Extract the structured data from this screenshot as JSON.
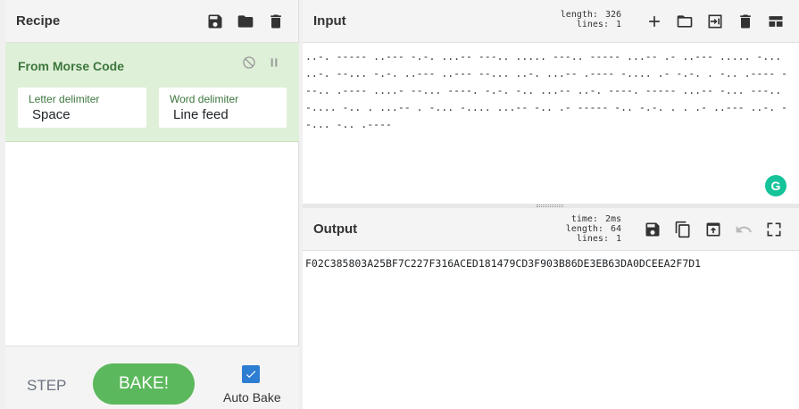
{
  "recipe": {
    "title": "Recipe",
    "icons": [
      "save-icon",
      "folder-icon",
      "trash-icon"
    ],
    "operation": {
      "name": "From Morse Code",
      "letter_delimiter": {
        "label": "Letter delimiter",
        "value": "Space"
      },
      "word_delimiter": {
        "label": "Word delimiter",
        "value": "Line feed"
      }
    },
    "controls": {
      "step_label": "STEP",
      "bake_label": "BAKE!",
      "auto_bake_label": "Auto Bake",
      "auto_bake_checked": true
    }
  },
  "input": {
    "title": "Input",
    "length_label": "length:",
    "length_value": "326",
    "lines_label": "lines:",
    "lines_value": "1",
    "text": "..-. ----- ..--- -.-. ...-- ---.. ..... ---.. ----- ...-- .- ..--- ..... -... ..-. --... -.-. ..--- ..--- --... ..-. ...-- .---- -.... .- -.-. . -.. .---- ---.. .---- ....- --... ----. -.-. -.. ...-- ..-. ----. ----- ...-- -... ---.. -.... -.. . ...-- . -... -.... ...-- -.. .- ----- -.. -.-. . . .- ..--- ..-. --... -.. .----"
  },
  "output": {
    "title": "Output",
    "time_label": "time:",
    "time_value": "2ms",
    "length_label": "length:",
    "length_value": "64",
    "lines_label": "lines:",
    "lines_value": "1",
    "text": "F02C385803A25BF7C227F316ACED181479CD3F903B86DE3EB63DA0DCEEA2F7D1"
  },
  "colors": {
    "operation_bg": "#dff0d8",
    "operation_text": "#3c763d",
    "bake_button": "#5cb85c",
    "checkbox": "#2d7dd2",
    "grammarly": "#15c39a"
  }
}
